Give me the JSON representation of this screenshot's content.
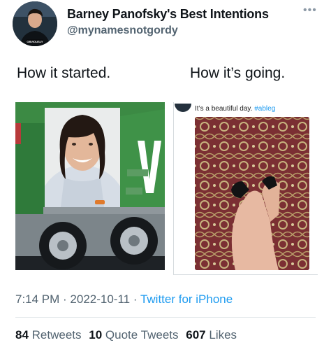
{
  "tweet": {
    "author_name": "Barney Panofsky's Best Intentions",
    "handle": "@mynamesnotgordy",
    "avatar_badge": "OBVIOUSLY",
    "caption_left": "How it started.",
    "caption_right": "How it’s going.",
    "time": "7:14 PM",
    "separator": " · ",
    "date": "2022-10-11",
    "source": "Twitter for iPhone"
  },
  "embedded": {
    "text": "It’s a beautiful day.",
    "hashtag": "#ableg"
  },
  "stats": {
    "retweets_count": "84",
    "retweets_label": "Retweets",
    "quotes_count": "10",
    "quotes_label": "Quote Tweets",
    "likes_count": "607",
    "likes_label": "Likes"
  },
  "colors": {
    "accent": "#1d9bf0",
    "muted": "#536471"
  },
  "icons": {
    "more": "more-icon"
  }
}
